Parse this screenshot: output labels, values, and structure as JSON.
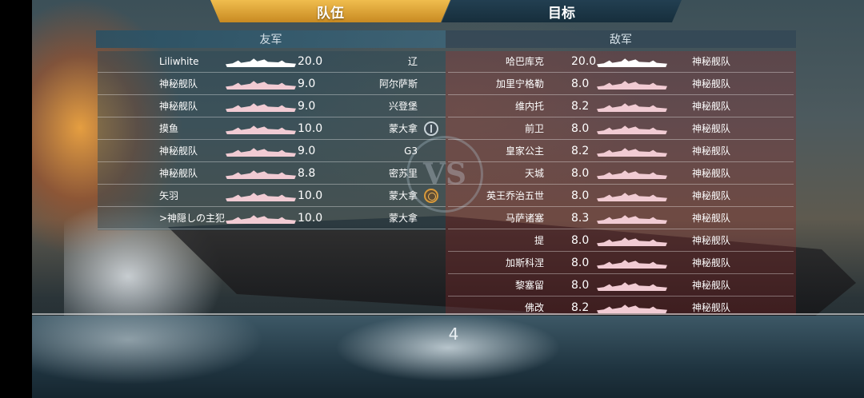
{
  "tabs": {
    "team": "队伍",
    "target": "目标"
  },
  "headers": {
    "ally": "友军",
    "enemy": "敌军"
  },
  "vs_label": "VS",
  "page_number": "4",
  "ally_rows": [
    {
      "player": "Liliwhite",
      "score": "20.0",
      "ship": "辽",
      "badge": ""
    },
    {
      "player": "神秘舰队",
      "score": "9.0",
      "ship": "阿尔萨斯",
      "badge": ""
    },
    {
      "player": "神秘舰队",
      "score": "9.0",
      "ship": "兴登堡",
      "badge": ""
    },
    {
      "player": "摸鱼",
      "score": "10.0",
      "ship": "蒙大拿",
      "badge": "compass-icon"
    },
    {
      "player": "神秘舰队",
      "score": "9.0",
      "ship": "G3",
      "badge": ""
    },
    {
      "player": "神秘舰队",
      "score": "8.8",
      "ship": "密苏里",
      "badge": ""
    },
    {
      "player": "矢羽",
      "score": "10.0",
      "ship": "蒙大拿",
      "badge": "helm-icon"
    },
    {
      "player": ">神隠しの主犯",
      "score": "10.0",
      "ship": "蒙大拿",
      "badge": ""
    }
  ],
  "enemy_rows": [
    {
      "ship": "哈巴库克",
      "score": "20.0",
      "player": "神秘舰队"
    },
    {
      "ship": "加里宁格勒",
      "score": "8.0",
      "player": "神秘舰队"
    },
    {
      "ship": "维内托",
      "score": "8.2",
      "player": "神秘舰队"
    },
    {
      "ship": "前卫",
      "score": "8.0",
      "player": "神秘舰队"
    },
    {
      "ship": "皇家公主",
      "score": "8.2",
      "player": "神秘舰队"
    },
    {
      "ship": "天城",
      "score": "8.0",
      "player": "神秘舰队"
    },
    {
      "ship": "英王乔治五世",
      "score": "8.0",
      "player": "神秘舰队"
    },
    {
      "ship": "马萨诸塞",
      "score": "8.3",
      "player": "神秘舰队"
    },
    {
      "ship": "提",
      "score": "8.0",
      "player": "神秘舰队"
    },
    {
      "ship": "加斯科涅",
      "score": "8.0",
      "player": "神秘舰队"
    },
    {
      "ship": "黎塞留",
      "score": "8.0",
      "player": "神秘舰队"
    },
    {
      "ship": "佛改",
      "score": "8.2",
      "player": "神秘舰队"
    }
  ],
  "colors": {
    "tab_active": "#e0a43a",
    "silhouette": "#f1cbd3",
    "enemy_tint": "#96282866"
  }
}
